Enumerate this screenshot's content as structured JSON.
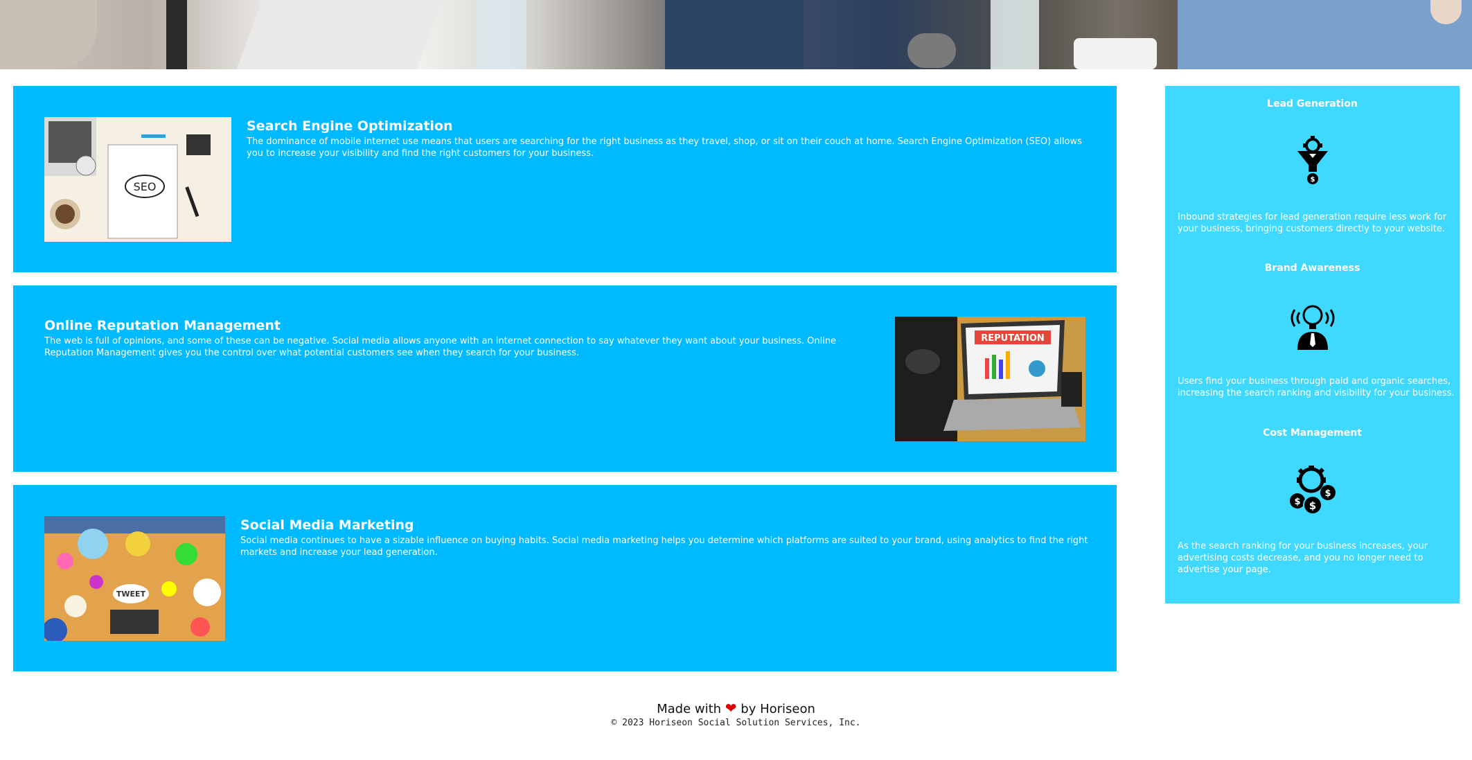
{
  "hero": {},
  "services": [
    {
      "title": "Search Engine Optimization",
      "text": "The dominance of mobile internet use means that users are searching for the right business as they travel, shop, or sit on their couch at home. Search Engine Optimization (SEO) allows you to increase your visibility and find the right customers for your business.",
      "image_label": "SEO"
    },
    {
      "title": "Online Reputation Management",
      "text": "The web is full of opinions, and some of these can be negative. Social media allows anyone with an internet connection to say whatever they want about your business. Online Reputation Management gives you the control over what potential customers see when they search for your business.",
      "image_label": "REPUTATION"
    },
    {
      "title": "Social Media Marketing",
      "text": "Social media continues to have a sizable influence on buying habits. Social media marketing helps you determine which platforms are suited to your brand, using analytics to find the right markets and increase your lead generation.",
      "image_label": "TWEET"
    }
  ],
  "benefits": [
    {
      "title": "Lead Generation",
      "text": "Inbound strategies for lead generation require less work for your business, bringing customers directly to your website.",
      "icon": "lead-funnel-icon"
    },
    {
      "title": "Brand Awareness",
      "text": "Users find your business through paid and organic searches, increasing the search ranking and visibility for your business.",
      "icon": "lightbulb-person-icon"
    },
    {
      "title": "Cost Management",
      "text": "As the search ranking for your business increases, your advertising costs decrease, and you no longer need to advertise your page.",
      "icon": "gear-coins-icon"
    }
  ],
  "footer": {
    "made_prefix": "Made with",
    "made_suffix": "by Horiseon",
    "copyright": "© 2023 Horiseon Social Solution Services, Inc."
  },
  "colors": {
    "card": "#00baff",
    "aside": "#3fd8ff",
    "heart": "#e20000"
  }
}
